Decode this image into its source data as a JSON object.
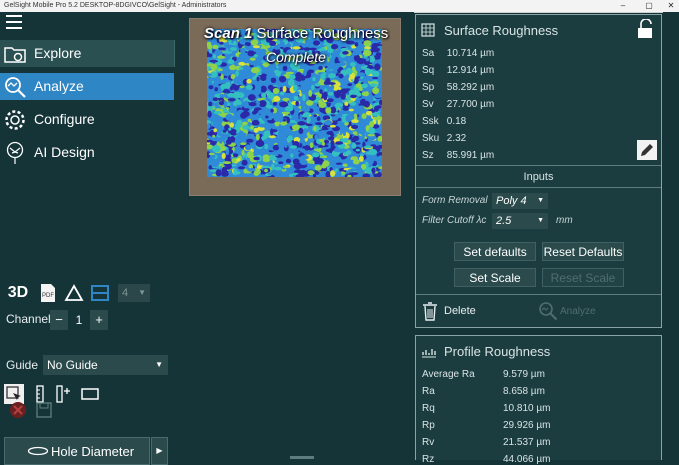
{
  "window": {
    "title": "GelSight Mobile Pro 5.2   DESKTOP-8DGIVCO\\GelSight - Administrators",
    "controls": [
      "–",
      "▢",
      "✕"
    ]
  },
  "sidebar": {
    "nav": [
      {
        "label": "Explore",
        "icon": "folder-camera-icon"
      },
      {
        "label": "Analyze",
        "icon": "magnifier-analyze-icon",
        "active": true
      },
      {
        "label": "Configure",
        "icon": "gear-icon"
      },
      {
        "label": "AI Design",
        "icon": "neural-tree-icon"
      }
    ],
    "tools": {
      "btn_3d": "3D",
      "pdf_label": "PDF",
      "num_select": "4"
    },
    "channel": {
      "label": "Channel",
      "minus": "−",
      "value": "1",
      "plus": "+"
    },
    "guide": {
      "label": "Guide",
      "value": "No Guide"
    },
    "hole_button": {
      "label": "Hole Diameter"
    }
  },
  "viewer": {
    "scan_label": "Scan 1",
    "title": "Surface Roughness",
    "status": "Complete"
  },
  "surface_panel": {
    "title": "Surface Roughness",
    "params": [
      {
        "name": "Sa",
        "value": "10.714 µm"
      },
      {
        "name": "Sq",
        "value": "12.914 µm"
      },
      {
        "name": "Sp",
        "value": "58.292 µm"
      },
      {
        "name": "Sv",
        "value": "27.700 µm"
      },
      {
        "name": "Ssk",
        "value": "0.18"
      },
      {
        "name": "Sku",
        "value": "2.32"
      },
      {
        "name": "Sz",
        "value": "85.991 µm"
      }
    ],
    "inputs_title": "Inputs",
    "form_removal": {
      "label": "Form Removal",
      "value": "Poly 4"
    },
    "filter_cutoff": {
      "label": "Filter Cutoff λc",
      "value": "2.5",
      "unit": "mm"
    },
    "buttons": {
      "set_defaults": "Set defaults",
      "reset_defaults": "Reset Defaults",
      "set_scale": "Set Scale",
      "reset_scale": "Reset Scale"
    },
    "delete_label": "Delete",
    "analyze_label": "Analyze"
  },
  "profile_panel": {
    "title": "Profile Roughness",
    "rows": [
      {
        "name": "Average Ra",
        "value": "9.579 µm"
      },
      {
        "name": "Ra",
        "value": "8.658 µm"
      },
      {
        "name": "Rq",
        "value": "10.810 µm"
      },
      {
        "name": "Rp",
        "value": "29.926 µm"
      },
      {
        "name": "Rv",
        "value": "21.537 µm"
      },
      {
        "name": "Rz",
        "value": "44.066 µm"
      }
    ]
  },
  "colors": {
    "background": "#153438",
    "active_nav": "#2f86c4",
    "panel": "#1b3d40",
    "heatmap": [
      "#2a2aa8",
      "#2f8ad8",
      "#35c0c0",
      "#8cd24a",
      "#d8e23a"
    ]
  }
}
